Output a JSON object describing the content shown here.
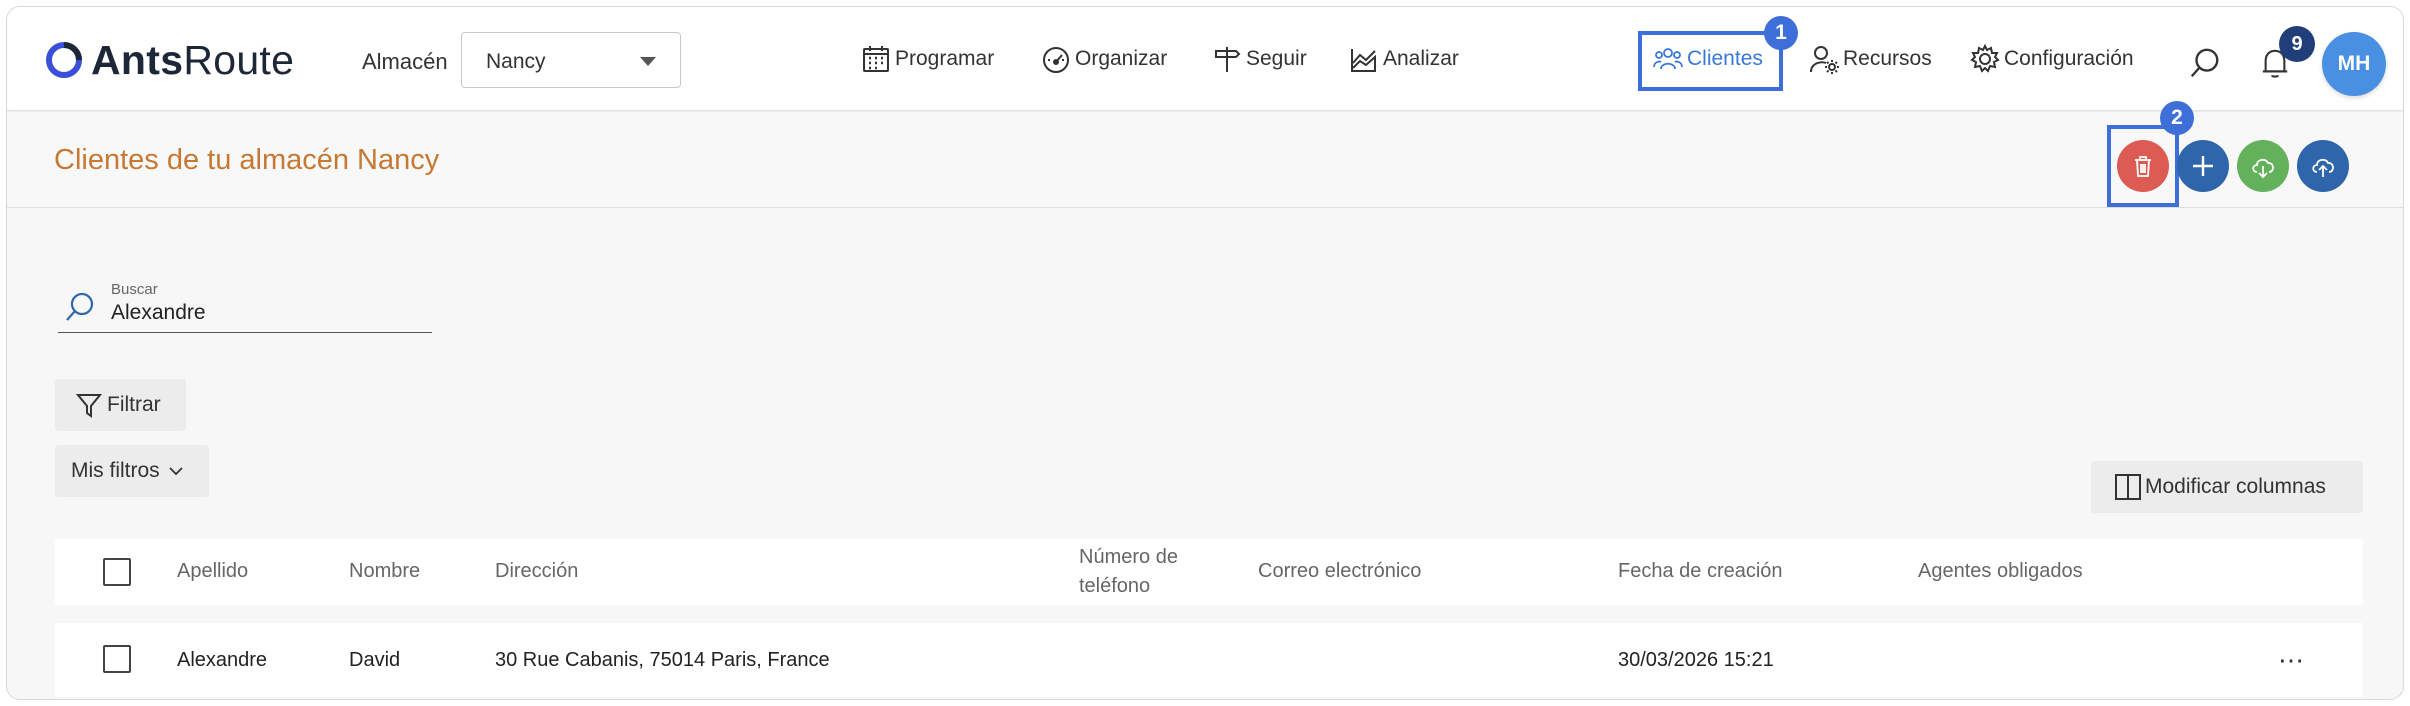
{
  "app": {
    "logo_bold": "Ants",
    "logo_light": "Route"
  },
  "warehouse": {
    "label": "Almacén",
    "value": "Nancy"
  },
  "nav": {
    "programar": "Programar",
    "organizar": "Organizar",
    "seguir": "Seguir",
    "analizar": "Analizar",
    "clientes": "Clientes",
    "recursos": "Recursos",
    "configuracion": "Configuración"
  },
  "step_badges": {
    "first": "1",
    "second": "2"
  },
  "notifications": {
    "count": "9"
  },
  "user": {
    "initials": "MH"
  },
  "page": {
    "title": "Clientes de tu almacén Nancy"
  },
  "search": {
    "label": "Buscar",
    "value": "Alexandre"
  },
  "filters": {
    "filter_label": "Filtrar",
    "my_filters_label": "Mis filtros"
  },
  "columns_button": "Modificar columnas",
  "table": {
    "headers": {
      "last_name": "Apellido",
      "first_name": "Nombre",
      "address": "Dirección",
      "phone": "Número de teléfono",
      "email": "Correo electrónico",
      "created": "Fecha de creación",
      "agents": "Agentes obligados"
    },
    "rows": [
      {
        "last_name": "Alexandre",
        "first_name": "David",
        "address": "30 Rue Cabanis, 75014 Paris, France",
        "phone": "",
        "email": "",
        "created": "30/03/2026 15:21",
        "agents": ""
      }
    ]
  },
  "colors": {
    "accent": "#3a78d8",
    "title": "#c77833",
    "delete": "#dc5b53",
    "add": "#2f66ab",
    "download": "#63b15a",
    "upload": "#2f66ab",
    "highlight": "#3e6fd8"
  },
  "icons": {
    "programar": "calendar-icon",
    "organizar": "gauge-icon",
    "seguir": "signpost-icon",
    "analizar": "chart-icon",
    "clientes": "users-icon",
    "recursos": "user-gear-icon",
    "configuracion": "gear-icon"
  }
}
